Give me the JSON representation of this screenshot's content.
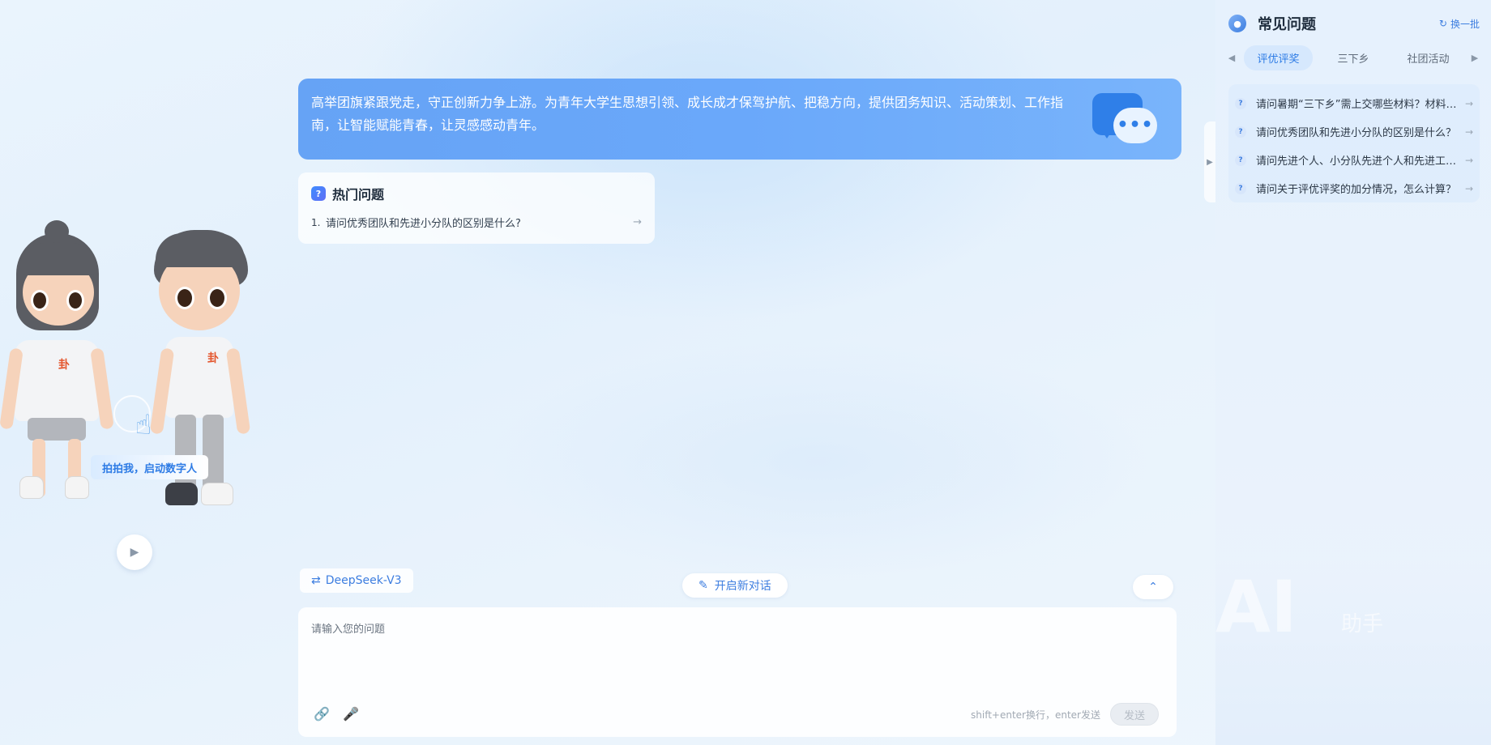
{
  "banner": {
    "text": "高举团旗紧跟党走，守正创新力争上游。为青年大学生思想引领、成长成才保驾护航、把稳方向，提供团务知识、活动策划、工作指南，让智能赋能青春，让灵感感动青年。",
    "icon": "chat-bubbles-icon"
  },
  "hot": {
    "title": "热门问题",
    "items": [
      {
        "num": "1.",
        "text": "请问优秀团队和先进小分队的区别是什么?"
      }
    ]
  },
  "avatar": {
    "tap_label": "拍拍我，启动数字人",
    "char_logo": "卦"
  },
  "model": {
    "name": "DeepSeek-V3"
  },
  "new_chat": {
    "label": "开启新对话"
  },
  "input": {
    "placeholder": "请输入您的问题",
    "hint": "shift+enter换行，enter发送",
    "send_label": "发送"
  },
  "faq": {
    "title": "常见问题",
    "refresh_label": "换一批",
    "tabs": [
      {
        "label": "评优评奖",
        "active": true
      },
      {
        "label": "三下乡",
        "active": false
      },
      {
        "label": "社团活动",
        "active": false
      }
    ],
    "items": [
      "请问暑期“三下乡”需上交哪些材料？材料提交时间是什么时候？",
      "请问优秀团队和先进小分队的区别是什么？",
      "请问先进个人、小分队先进个人和先进工作者的区别是什么？",
      "请问关于评优评奖的加分情况，怎么计算？"
    ]
  },
  "watermark": {
    "ai": "AI",
    "zs": "助手"
  },
  "colors": {
    "accent": "#3d7ee0",
    "banner": "#6aa8fa",
    "page_bg": "#e6f1fd"
  }
}
